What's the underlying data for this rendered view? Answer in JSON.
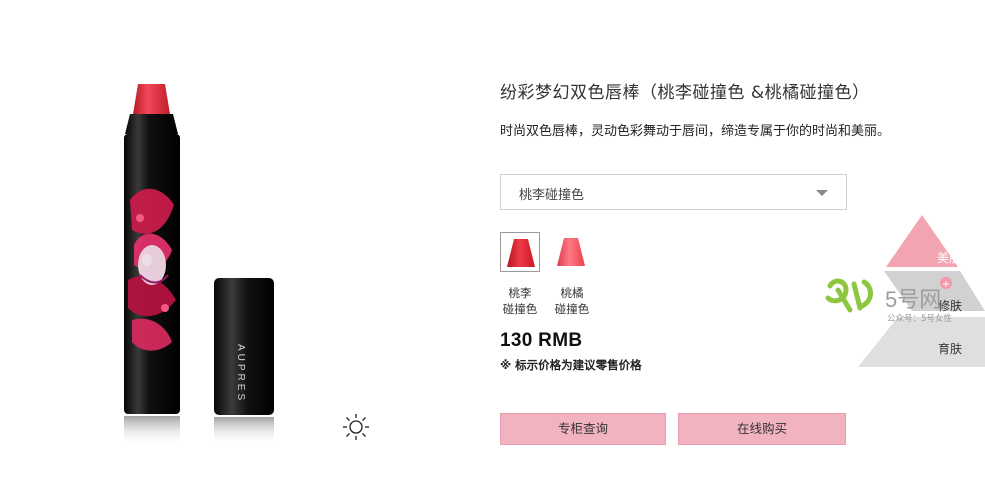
{
  "product": {
    "title": "纷彩梦幻双色唇棒（桃李碰撞色 &桃橘碰撞色）",
    "description": "时尚双色唇棒，灵动色彩舞动于唇间，缔造专属于你的时尚和美丽。",
    "brand_on_cap": "AUPRES"
  },
  "color_select": {
    "selected": "桃李碰撞色"
  },
  "swatches": [
    {
      "label_line1": "桃李",
      "label_line2": "碰撞色",
      "color": "#d8242f"
    },
    {
      "label_line1": "桃橘",
      "label_line2": "碰撞色",
      "color": "#ef4a57"
    }
  ],
  "price": {
    "value": "130 RMB",
    "note": "※ 标示价格为建议零售价格"
  },
  "buttons": {
    "counter_query": "专柜查询",
    "buy_online": "在线购买"
  },
  "watermark": {
    "tier1": "美肤",
    "tier2": "修肤",
    "tier3": "育肤",
    "logo_text": "5号网",
    "sub": "公众号：5号女性"
  },
  "colors": {
    "accent_button": "#f2b3c0",
    "lipstick_red": "#d8242f",
    "lipstick_body": "#111111"
  }
}
